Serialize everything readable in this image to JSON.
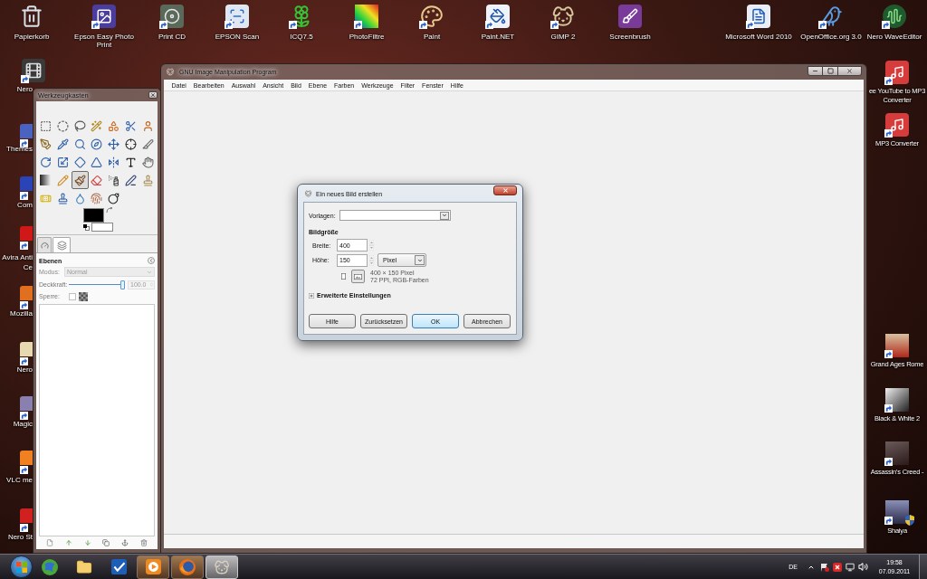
{
  "desktop": {
    "top_icons": [
      {
        "lines": [
          "Papierkorb"
        ],
        "shortcut": false
      },
      {
        "lines": [
          "Epson Easy Photo",
          "Print"
        ],
        "shortcut": true
      },
      {
        "lines": [
          "Print CD"
        ],
        "shortcut": true
      },
      {
        "lines": [
          "EPSON Scan"
        ],
        "shortcut": true
      },
      {
        "lines": [
          "ICQ7.5"
        ],
        "shortcut": true
      },
      {
        "lines": [
          "PhotoFiltre"
        ],
        "shortcut": true
      },
      {
        "lines": [
          "Paint"
        ],
        "shortcut": true
      },
      {
        "lines": [
          "Paint.NET"
        ],
        "shortcut": true
      },
      {
        "lines": [
          "GIMP 2"
        ],
        "shortcut": true
      },
      {
        "lines": [
          "Screenbrush"
        ],
        "shortcut": false
      },
      {
        "lines": [
          "Microsoft Word 2010"
        ],
        "shortcut": true
      },
      {
        "lines": [
          "OpenOffice.org 3.0"
        ],
        "shortcut": true
      },
      {
        "lines": [
          "Nero WaveEditor"
        ],
        "shortcut": true
      }
    ],
    "left_icons": [
      {
        "lines": [
          "Nero"
        ],
        "shortcut": true
      },
      {
        "lines": [
          "Themes"
        ],
        "shortcut": true
      },
      {
        "lines": [
          "Com"
        ],
        "shortcut": true
      },
      {
        "lines": [
          "Avira Anti",
          "Ce"
        ],
        "shortcut": true
      },
      {
        "lines": [
          "Mozilla"
        ],
        "shortcut": true
      },
      {
        "lines": [
          "Nero"
        ],
        "shortcut": true
      },
      {
        "lines": [
          "Magic"
        ],
        "shortcut": true
      },
      {
        "lines": [
          "VLC me"
        ],
        "shortcut": true
      },
      {
        "lines": [
          "Nero St"
        ],
        "shortcut": true
      }
    ],
    "right_icons": [
      {
        "lines": [
          "ee YouTube to MP3",
          "Converter"
        ],
        "shortcut": true
      },
      {
        "lines": [
          "MP3 Converter"
        ],
        "shortcut": true
      },
      {
        "lines": [
          "Grand Ages Rome"
        ],
        "shortcut": true
      },
      {
        "lines": [
          "Black & White 2"
        ],
        "shortcut": true
      },
      {
        "lines": [
          "Assassin's Creed -"
        ],
        "shortcut": true
      },
      {
        "lines": [
          "Shaiya"
        ],
        "shortcut": true
      }
    ]
  },
  "gimp_window": {
    "title": "GNU Image Manipulation Program",
    "menu": [
      "Datei",
      "Bearbeiten",
      "Auswahl",
      "Ansicht",
      "Bild",
      "Ebene",
      "Farben",
      "Werkzeuge",
      "Filter",
      "Fenster",
      "Hilfe"
    ]
  },
  "toolbox": {
    "title": "Werkzeugkasten",
    "tools": [
      {
        "selected": false
      },
      {
        "selected": false
      },
      {
        "selected": false
      },
      {
        "selected": false
      },
      {
        "selected": false
      },
      {
        "selected": false
      },
      {
        "selected": false
      },
      {
        "selected": false
      },
      {
        "selected": false
      },
      {
        "selected": false
      },
      {
        "selected": false
      },
      {
        "selected": false
      },
      {
        "selected": false
      },
      {
        "selected": false
      },
      {
        "selected": false
      },
      {
        "selected": false
      },
      {
        "selected": false
      },
      {
        "selected": false
      },
      {
        "selected": false
      },
      {
        "selected": false
      },
      {
        "selected": false
      },
      {
        "selected": false
      },
      {
        "selected": false
      },
      {
        "selected": true
      },
      {
        "selected": false
      },
      {
        "selected": false
      },
      {
        "selected": false
      },
      {
        "selected": false
      },
      {
        "selected": false
      },
      {
        "selected": false
      },
      {
        "selected": false
      },
      {
        "selected": false
      },
      {
        "selected": false
      }
    ],
    "color_swatches": [
      {
        "color": "#000000"
      },
      {
        "color": "#ffffff"
      }
    ],
    "tabs": [
      {
        "selected": false
      },
      {
        "selected": true
      }
    ],
    "layers_panel": {
      "title": "Ebenen",
      "mode": {
        "label": "Modus:",
        "value": "Normal",
        "disabled": true
      },
      "opacity": {
        "label": "Deckkraft:",
        "level": 1.0,
        "reading": "100.0"
      },
      "lock": {
        "label": "Sperre:",
        "checked": false
      }
    }
  },
  "dialog": {
    "title": "Ein neues Bild erstellen",
    "template": {
      "label": "Vorlagen:"
    },
    "section": "Bildgröße",
    "width": {
      "label": "Breite:",
      "value": "400"
    },
    "height": {
      "label": "Höhe:",
      "value": "150"
    },
    "unit": "Pixel",
    "orientation": [
      {
        "selected": false
      },
      {
        "selected": true
      }
    ],
    "info_lines": [
      "400 × 150 Pixel",
      "72 PPI, RGB-Farben"
    ],
    "advanced": {
      "label": "Erweiterte Einstellungen",
      "expanded": false
    },
    "buttons": [
      {
        "label": "Hilfe",
        "default": false
      },
      {
        "label": "Zurücksetzen",
        "default": false
      },
      {
        "label": "OK",
        "default": true
      },
      {
        "label": "Abbrechen",
        "default": false
      }
    ]
  },
  "taskbar": {
    "buttons": [
      {
        "running": false,
        "active": false
      },
      {
        "running": false,
        "active": false
      },
      {
        "running": false,
        "active": false
      },
      {
        "running": true,
        "active": false
      },
      {
        "running": true,
        "active": false
      },
      {
        "running": true,
        "active": true
      }
    ],
    "tray": {
      "language": "DE",
      "time": "19:58",
      "date": "07.09.2011"
    }
  }
}
